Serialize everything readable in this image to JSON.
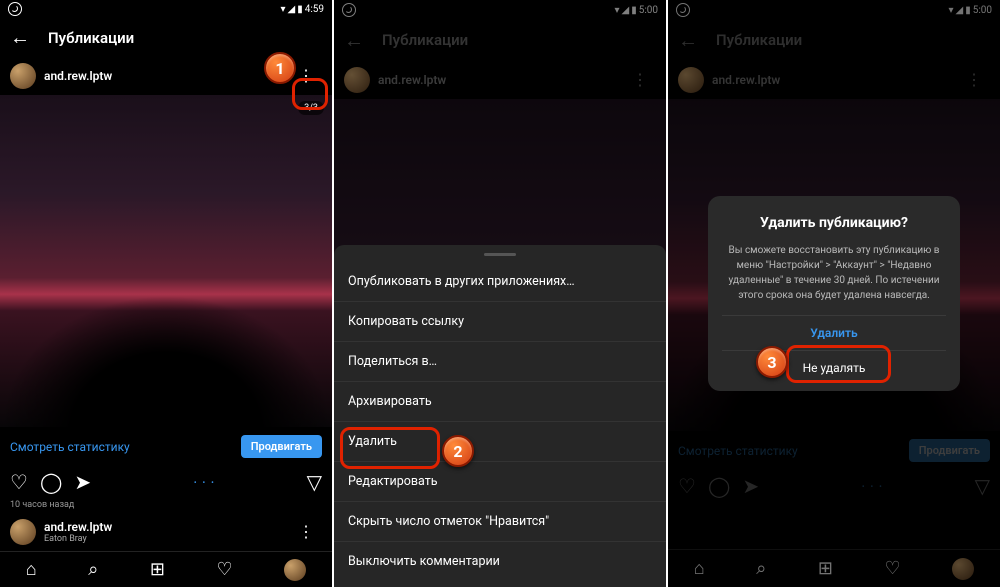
{
  "status": {
    "time1": "4:59",
    "time2": "5:00",
    "time3": "5:00"
  },
  "header": {
    "title": "Публикации"
  },
  "user": {
    "name": "and.rew.lptw",
    "location": "Eaton Bray"
  },
  "post": {
    "carousel": "3/3",
    "time": "10 часов назад"
  },
  "stats": {
    "link": "Смотреть статистику",
    "promote": "Продвигать"
  },
  "sheet": {
    "items": [
      "Опубликовать в других приложениях…",
      "Копировать ссылку",
      "Поделиться в…",
      "Архивировать",
      "Удалить",
      "Редактировать",
      "Скрыть число отметок \"Нравится\"",
      "Выключить комментарии"
    ]
  },
  "dialog": {
    "title": "Удалить публикацию?",
    "body": "Вы сможете восстановить эту публикацию в меню \"Настройки\" > \"Аккаунт\" > \"Недавно удаленные\" в течение 30 дней. По истечении этого срока она будет удалена навсегда.",
    "confirm": "Удалить",
    "cancel": "Не удалять"
  },
  "callouts": {
    "c1": "1",
    "c2": "2",
    "c3": "3"
  }
}
